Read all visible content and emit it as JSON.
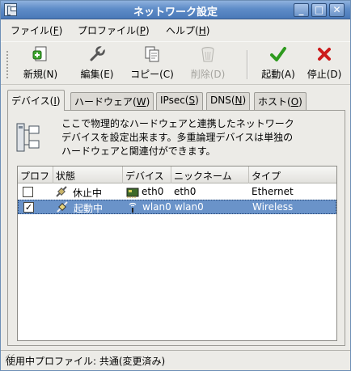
{
  "window": {
    "title": "ネットワーク設定",
    "minimize": "_",
    "maximize": "□",
    "close": "✕"
  },
  "menubar": [
    {
      "label": "ファイル(",
      "key": "F",
      "end": ")"
    },
    {
      "label": "プロファイル(",
      "key": "P",
      "end": ")"
    },
    {
      "label": "ヘルプ(",
      "key": "H",
      "end": ")"
    }
  ],
  "toolbar": {
    "new": "新規(N)",
    "edit": "編集(E)",
    "copy": "コピー(C)",
    "delete": "削除(D)",
    "activate": "起動(A)",
    "deactivate": "停止(D)"
  },
  "tabs": [
    {
      "label": "デバイス(",
      "key": "I",
      "end": ")"
    },
    {
      "label": "ハードウェア(",
      "key": "W",
      "end": ")"
    },
    {
      "label": "IPsec(",
      "key": "S",
      "end": ")"
    },
    {
      "label": "DNS(",
      "key": "N",
      "end": ")"
    },
    {
      "label": "ホスト(",
      "key": "O",
      "end": ")"
    }
  ],
  "description": [
    "ここで物理的なハードウェアと連携したネットワーク",
    "デバイスを設定出来ます。多重論理デバイスは単独の",
    "ハードウェアと関連付ができます。"
  ],
  "columns": [
    "プロフ",
    "状態",
    "デバイス",
    "ニックネーム",
    "タイプ"
  ],
  "rows": [
    {
      "profile": false,
      "check": "",
      "status": "休止中",
      "device": "eth0",
      "nickname": "eth0",
      "type": "Ethernet",
      "device_icon": "ethernet-card-icon",
      "status_icon": "inactive-plug-icon"
    },
    {
      "profile": true,
      "check": "✓",
      "status": "起動中",
      "device": "wlan0",
      "nickname": "wlan0",
      "type": "Wireless",
      "device_icon": "wireless-icon",
      "status_icon": "active-plug-icon"
    }
  ],
  "statusbar": "使用中プロファイル: 共通(変更済み)",
  "colors": {
    "selection": "#6a93c9",
    "titlebar": "#5e8cc8",
    "activate_green": "#2e9a1e",
    "stop_red": "#cc1b1b"
  }
}
